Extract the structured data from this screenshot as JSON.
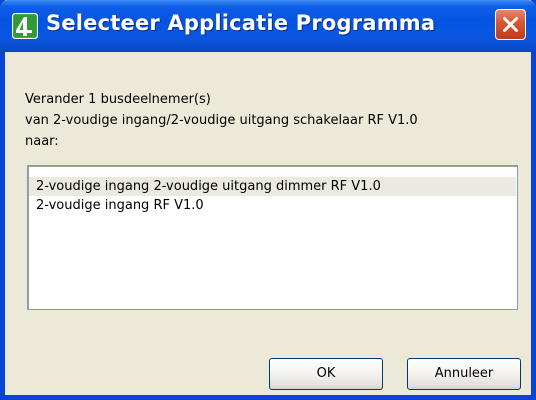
{
  "window": {
    "title": "Selecteer Applicatie Programma",
    "close_label": "Close"
  },
  "message": {
    "line1": "Verander 1 busdeelnemer(s)",
    "line2": "van 2-voudige ingang/2-voudige uitgang schakelaar RF V1.0",
    "line3": "naar:"
  },
  "list": {
    "items": [
      {
        "label": "2-voudige ingang 2-voudige uitgang dimmer RF V1.0",
        "selected": true
      },
      {
        "label": "2-voudige ingang RF V1.0",
        "selected": false
      }
    ]
  },
  "buttons": {
    "ok_label": "OK",
    "cancel_label": "Annuleer"
  },
  "icons": {
    "app": "app-icon",
    "close": "close-icon"
  },
  "colors": {
    "titlebar": "#0454e3",
    "dialog_background": "#ece9d8",
    "close_button": "#d65434",
    "selected_item_background": "#ebe9e0"
  }
}
